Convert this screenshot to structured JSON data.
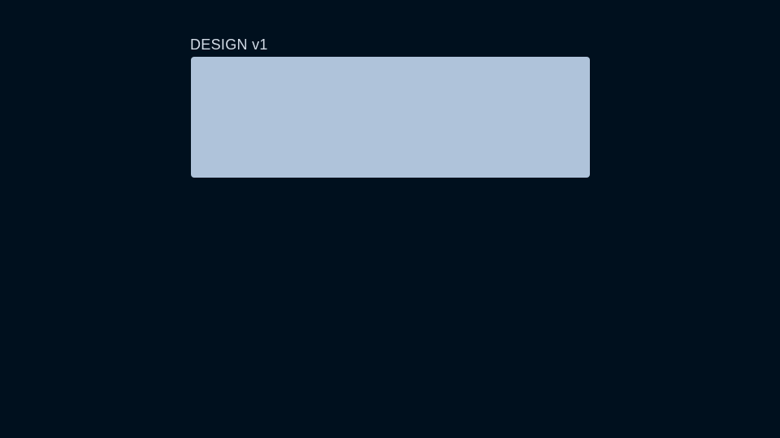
{
  "header": {
    "label": "DESIGN v1"
  },
  "colors": {
    "background": "#00101e",
    "label_text": "#d2dbe6",
    "panel_fill": "#afc3da"
  }
}
